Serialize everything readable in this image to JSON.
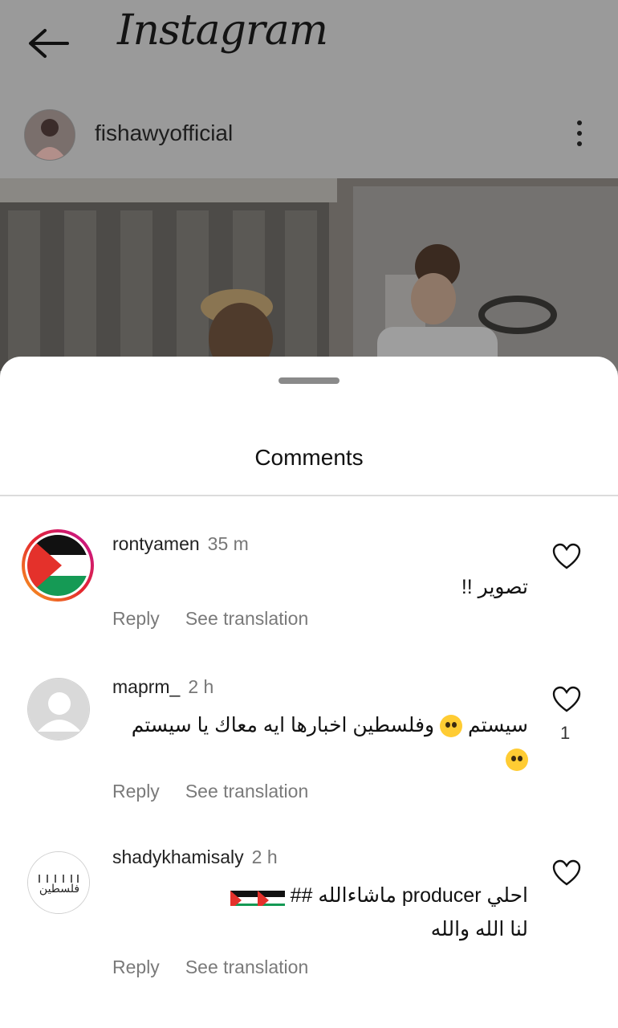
{
  "app": {
    "title": "Instagram"
  },
  "post": {
    "username": "fishawyofficial"
  },
  "sheet": {
    "title": "Comments"
  },
  "comments": [
    {
      "username": "rontyamen",
      "time": "35 m",
      "text": "تصوير !!",
      "reply": "Reply",
      "translate": "See translation",
      "avatar": "palestine-flag-avatar",
      "likes": ""
    },
    {
      "username": "maprm_",
      "time": "2 h",
      "text_line1": "سيستم",
      "text_line1b": "وفلسطين اخبارها ايه معاك يا سيستم",
      "reply": "Reply",
      "translate": "See translation",
      "avatar": "default-avatar",
      "likes": "1"
    },
    {
      "username": "shadykhamisaly",
      "time": "2 h",
      "text_line1": "احلي producer ماشاءالله ##",
      "text_line2": "لنا الله والله",
      "reply": "Reply",
      "translate": "See translation",
      "avatar": "palestine-logo-avatar",
      "avatar_text": "فلسطين",
      "likes": ""
    }
  ],
  "colors": {
    "heart": "#111111",
    "muted": "#7a7a7a",
    "palestine_red": "#e4312b",
    "palestine_green": "#149954"
  }
}
